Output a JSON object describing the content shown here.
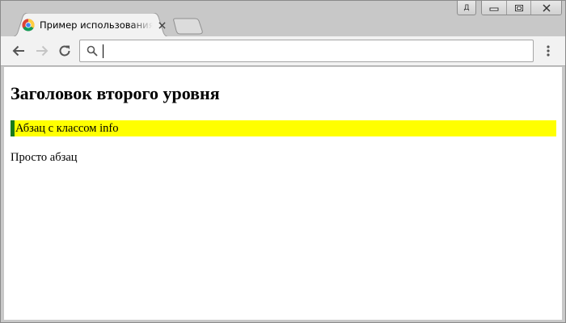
{
  "browser": {
    "tab": {
      "title": "Пример использования jQuery",
      "favicon": "chrome-favicon-icon",
      "close_icon": "close-icon"
    },
    "new_tab_icon": "new-tab-icon",
    "profile_label": "Д",
    "window_controls": [
      "minimize-icon",
      "restore-icon",
      "close-icon"
    ],
    "toolbar": {
      "back_icon": "arrow-left-icon",
      "forward_icon": "arrow-right-icon",
      "reload_icon": "reload-icon",
      "omnibox_value": "",
      "omnibox_search_icon": "search-icon",
      "menu_icon": "vertical-dots-icon"
    }
  },
  "page": {
    "heading": "Заголовок второго уровня",
    "info_paragraph": "Абзац с классом info",
    "plain_paragraph": "Просто абзац"
  },
  "colors": {
    "info_background": "#ffff00",
    "info_border": "#1a7a1a"
  }
}
